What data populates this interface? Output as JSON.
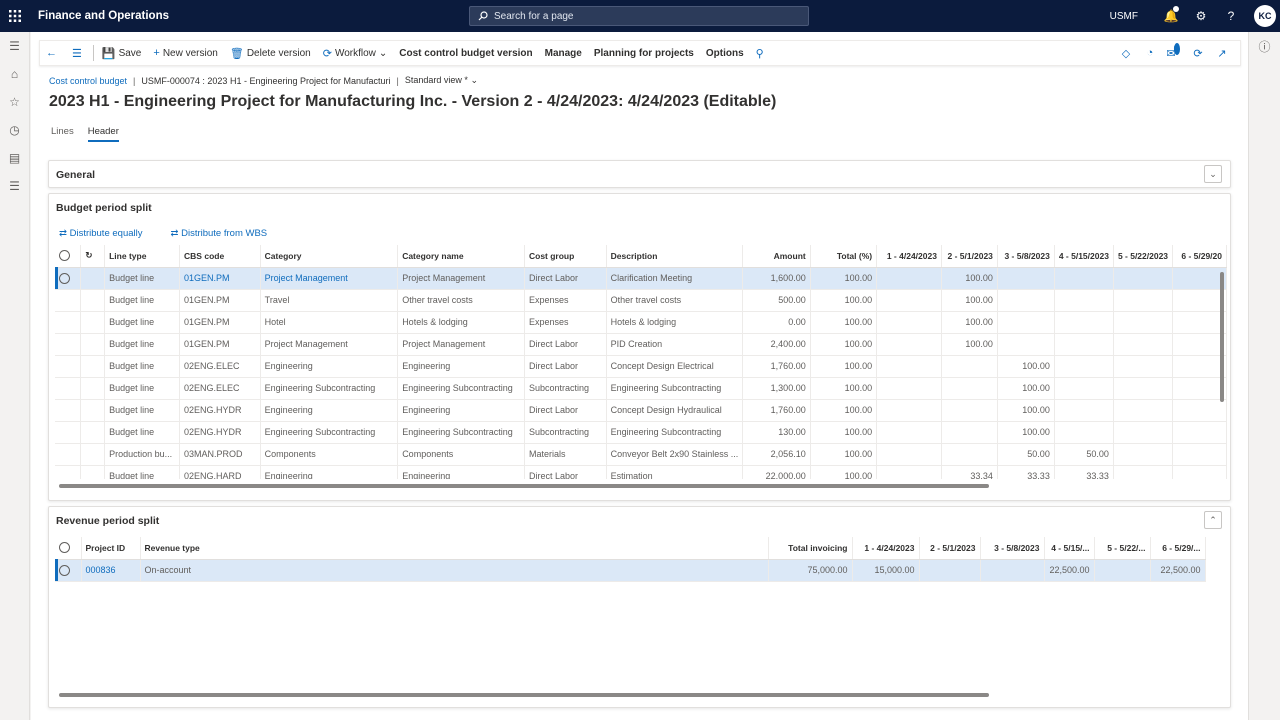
{
  "topbar": {
    "app_title": "Finance and Operations",
    "search_placeholder": "Search for a page",
    "company": "USMF",
    "avatar": "KC"
  },
  "actions": {
    "save": "Save",
    "new_version": "New version",
    "delete_version": "Delete version",
    "workflow": "Workflow",
    "cost_control": "Cost control budget version",
    "manage": "Manage",
    "planning": "Planning for projects",
    "options": "Options"
  },
  "notif_count": "0",
  "breadcrumb": {
    "root": "Cost control budget",
    "record": "USMF-000074 : 2023 H1 - Engineering Project for Manufacturi",
    "view": "Standard view *"
  },
  "title": "2023 H1 - Engineering Project for Manufacturing Inc. - Version 2 - 4/24/2023: 4/24/2023 (Editable)",
  "tabs": {
    "lines": "Lines",
    "header": "Header"
  },
  "general": {
    "title": "General"
  },
  "budget": {
    "title": "Budget period split",
    "distribute_equally": "Distribute equally",
    "distribute_wbs": "Distribute from WBS",
    "columns": [
      "Line type",
      "CBS code",
      "Category",
      "Category name",
      "Cost group",
      "Description",
      "Amount",
      "Total (%)",
      "1 - 4/24/2023",
      "2 - 5/1/2023",
      "3 - 5/8/2023",
      "4 - 5/15/2023",
      "5 - 5/22/2023",
      "6 - 5/29/20"
    ],
    "rows": [
      [
        "Budget line",
        "01GEN.PM",
        "Project Management",
        "Project Management",
        "Direct Labor",
        "Clarification Meeting",
        "1,600.00",
        "100.00",
        "",
        "100.00",
        "",
        "",
        "",
        ""
      ],
      [
        "Budget line",
        "01GEN.PM",
        "Travel",
        "Other travel costs",
        "Expenses",
        "Other travel costs",
        "500.00",
        "100.00",
        "",
        "100.00",
        "",
        "",
        "",
        ""
      ],
      [
        "Budget line",
        "01GEN.PM",
        "Hotel",
        "Hotels & lodging",
        "Expenses",
        "Hotels & lodging",
        "0.00",
        "100.00",
        "",
        "100.00",
        "",
        "",
        "",
        ""
      ],
      [
        "Budget line",
        "01GEN.PM",
        "Project Management",
        "Project Management",
        "Direct Labor",
        "PID Creation",
        "2,400.00",
        "100.00",
        "",
        "100.00",
        "",
        "",
        "",
        ""
      ],
      [
        "Budget line",
        "02ENG.ELEC",
        "Engineering",
        "Engineering",
        "Direct Labor",
        "Concept Design Electrical",
        "1,760.00",
        "100.00",
        "",
        "",
        "100.00",
        "",
        "",
        ""
      ],
      [
        "Budget line",
        "02ENG.ELEC",
        "Engineering Subcontracting",
        "Engineering Subcontracting",
        "Subcontracting",
        "Engineering Subcontracting",
        "1,300.00",
        "100.00",
        "",
        "",
        "100.00",
        "",
        "",
        ""
      ],
      [
        "Budget line",
        "02ENG.HYDR",
        "Engineering",
        "Engineering",
        "Direct Labor",
        "Concept Design Hydraulical",
        "1,760.00",
        "100.00",
        "",
        "",
        "100.00",
        "",
        "",
        ""
      ],
      [
        "Budget line",
        "02ENG.HYDR",
        "Engineering Subcontracting",
        "Engineering Subcontracting",
        "Subcontracting",
        "Engineering Subcontracting",
        "130.00",
        "100.00",
        "",
        "",
        "100.00",
        "",
        "",
        ""
      ],
      [
        "Production bu...",
        "03MAN.PROD",
        "Components",
        "Components",
        "Materials",
        "Conveyor Belt 2x90 Stainless ...",
        "2,056.10",
        "100.00",
        "",
        "",
        "50.00",
        "50.00",
        "",
        ""
      ],
      [
        "Budget line",
        "02ENG.HARD",
        "Engineering",
        "Engineering",
        "Direct Labor",
        "Estimation",
        "22,000.00",
        "100.00",
        "",
        "33.34",
        "33.33",
        "33.33",
        "",
        ""
      ]
    ]
  },
  "revenue": {
    "title": "Revenue period split",
    "columns": [
      "Project ID",
      "Revenue type",
      "Total invoicing",
      "1 - 4/24/2023",
      "2 - 5/1/2023",
      "3 - 5/8/2023",
      "4 - 5/15/...",
      "5 - 5/22/...",
      "6 - 5/29/..."
    ],
    "rows": [
      [
        "000836",
        "On-account",
        "75,000.00",
        "15,000.00",
        "",
        "",
        "22,500.00",
        "",
        "22,500.00"
      ]
    ]
  }
}
